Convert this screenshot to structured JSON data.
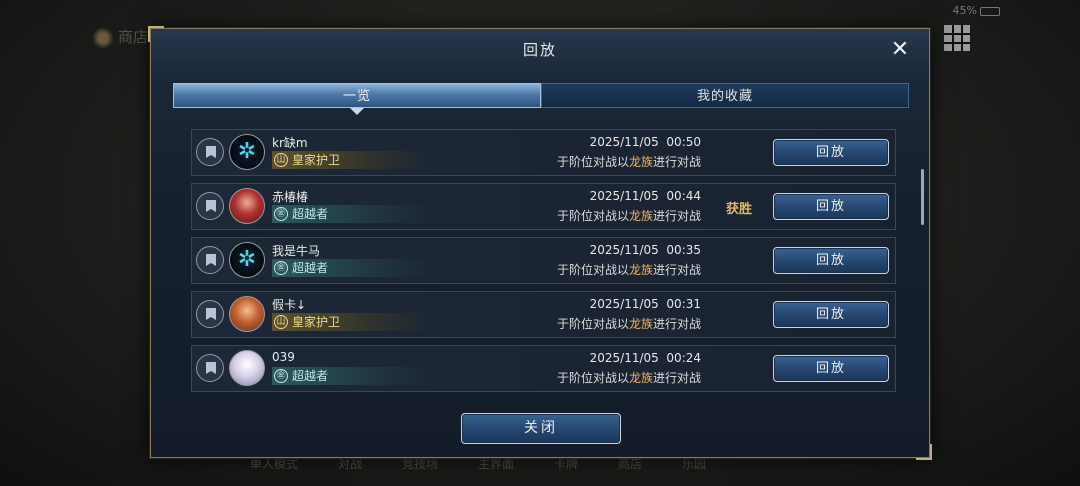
{
  "background": {
    "top_left_label": "商店",
    "battery": "45%",
    "bottom_nav": [
      "单人模式",
      "对战",
      "竞技场",
      "主界面",
      "卡牌",
      "商店",
      "乐园"
    ]
  },
  "dialog": {
    "title": "回放",
    "close_icon": "✕",
    "tabs": [
      {
        "label": "一览",
        "active": true
      },
      {
        "label": "我的收藏",
        "active": false
      }
    ],
    "replay_label": "回放",
    "close_button_label": "关闭"
  },
  "records": [
    {
      "name": "kr缺m",
      "avatar": "emblem-icon",
      "rank": "皇家护卫",
      "rank_style": "gold",
      "rank_icon": "山",
      "datetime": "2025/11/05  00:50",
      "desc_prefix": "于阶位对战以",
      "desc_highlight": "龙族",
      "desc_suffix": "进行对战",
      "result": ""
    },
    {
      "name": "赤椿椿",
      "avatar": "portrait-red",
      "rank": "超越者",
      "rank_style": "teal",
      "rank_icon": "㊎",
      "datetime": "2025/11/05  00:44",
      "desc_prefix": "于阶位对战以",
      "desc_highlight": "龙族",
      "desc_suffix": "进行对战",
      "result": "获胜"
    },
    {
      "name": "我是牛马",
      "avatar": "emblem-icon",
      "rank": "超越者",
      "rank_style": "teal",
      "rank_icon": "㊎",
      "datetime": "2025/11/05  00:35",
      "desc_prefix": "于阶位对战以",
      "desc_highlight": "龙族",
      "desc_suffix": "进行对战",
      "result": ""
    },
    {
      "name": "假卡↓",
      "avatar": "portrait-orange",
      "rank": "皇家护卫",
      "rank_style": "gold",
      "rank_icon": "山",
      "datetime": "2025/11/05  00:31",
      "desc_prefix": "于阶位对战以",
      "desc_highlight": "龙族",
      "desc_suffix": "进行对战",
      "result": ""
    },
    {
      "name": "039",
      "avatar": "portrait-white",
      "rank": "超越者",
      "rank_style": "teal",
      "rank_icon": "㊎",
      "datetime": "2025/11/05  00:24",
      "desc_prefix": "于阶位对战以",
      "desc_highlight": "龙族",
      "desc_suffix": "进行对战",
      "result": ""
    }
  ],
  "colors": {
    "highlight": "#f2b25a",
    "result": "#e0b860",
    "tab_active": "#4c79a8",
    "button": "#244670"
  }
}
